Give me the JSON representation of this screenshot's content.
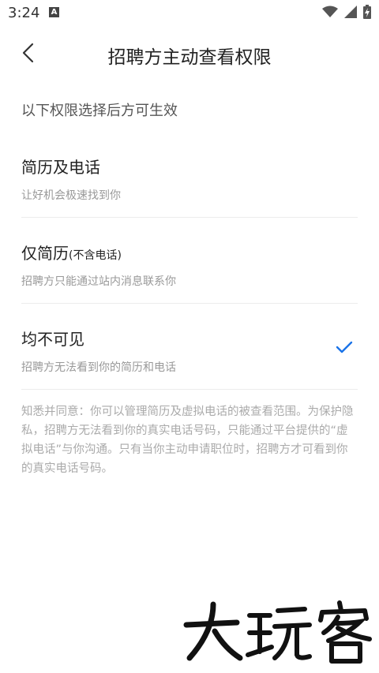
{
  "status_bar": {
    "time": "3:24",
    "app_icon_letter": "A"
  },
  "header": {
    "title": "招聘方主动查看权限"
  },
  "intro": "以下权限选择后方可生效",
  "options": [
    {
      "title": "简历及电话",
      "title_note": "",
      "desc": "让好机会极速找到你",
      "selected": false
    },
    {
      "title": "仅简历",
      "title_note": "(不含电话)",
      "desc": "招聘方只能通过站内消息联系你",
      "selected": false
    },
    {
      "title": "均不可见",
      "title_note": "",
      "desc": "招聘方无法看到你的简历和电话",
      "selected": true
    }
  ],
  "notice": "知悉并同意：你可以管理简历及虚拟电话的被查看范围。为保护隐私，招聘方无法看到你的真实电话号码，只能通过平台提供的“虚拟电话”与你沟通。只有当你主动申请职位时，招聘方才可看到你的真实电话号码。",
  "watermark": "大玩客",
  "colors": {
    "accent": "#1a73e8",
    "text_primary": "#222222",
    "text_secondary": "#999999",
    "divider": "#ececec"
  }
}
